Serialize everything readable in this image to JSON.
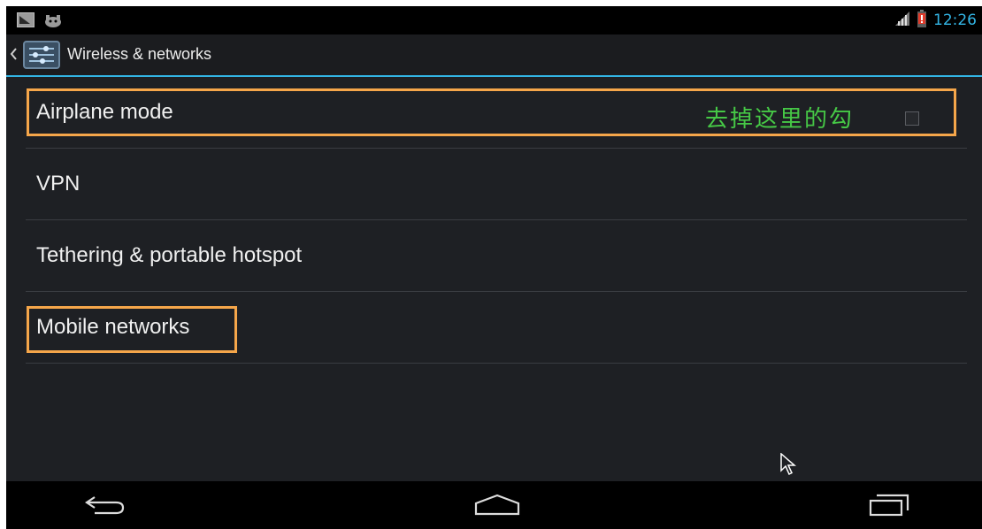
{
  "status_bar": {
    "left_icons": [
      "screenshot-icon",
      "android-debug-icon"
    ],
    "right_icons": [
      "signal-icon",
      "battery-low-icon"
    ],
    "time": "12:26"
  },
  "action_bar": {
    "icons": [
      "up-caret-icon",
      "settings-app-icon"
    ],
    "title": "Wireless & networks"
  },
  "list": {
    "items": [
      {
        "label": "Airplane mode",
        "checked": false
      },
      {
        "label": "VPN"
      },
      {
        "label": "Tethering & portable hotspot"
      },
      {
        "label": "Mobile networks"
      }
    ]
  },
  "annotation": {
    "text": "去掉这里的勾",
    "color": "#46c846",
    "highlight_color": "#f5a64a"
  },
  "nav_bar": {
    "icons": [
      "back-icon",
      "home-icon",
      "recent-apps-icon"
    ]
  },
  "colors": {
    "accent": "#33b5e5",
    "background": "#1e2024"
  }
}
